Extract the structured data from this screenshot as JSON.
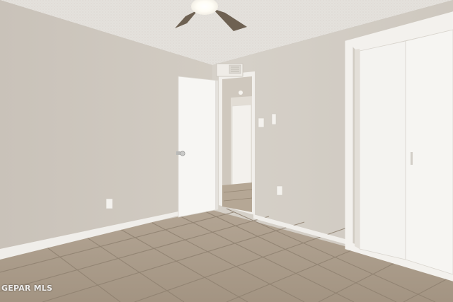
{
  "photo": {
    "description_tag": "empty-bedroom-interior",
    "watermark": "GEPAR MLS"
  },
  "colors": {
    "wall_left": "#cdc6bd",
    "wall_right": "#d4cec6",
    "ceiling": "#e6e3de",
    "floor_tile": "#a89a88",
    "grout": "#8d7f6e",
    "trim": "#f2f0ec",
    "door": "#f6f5f2"
  }
}
